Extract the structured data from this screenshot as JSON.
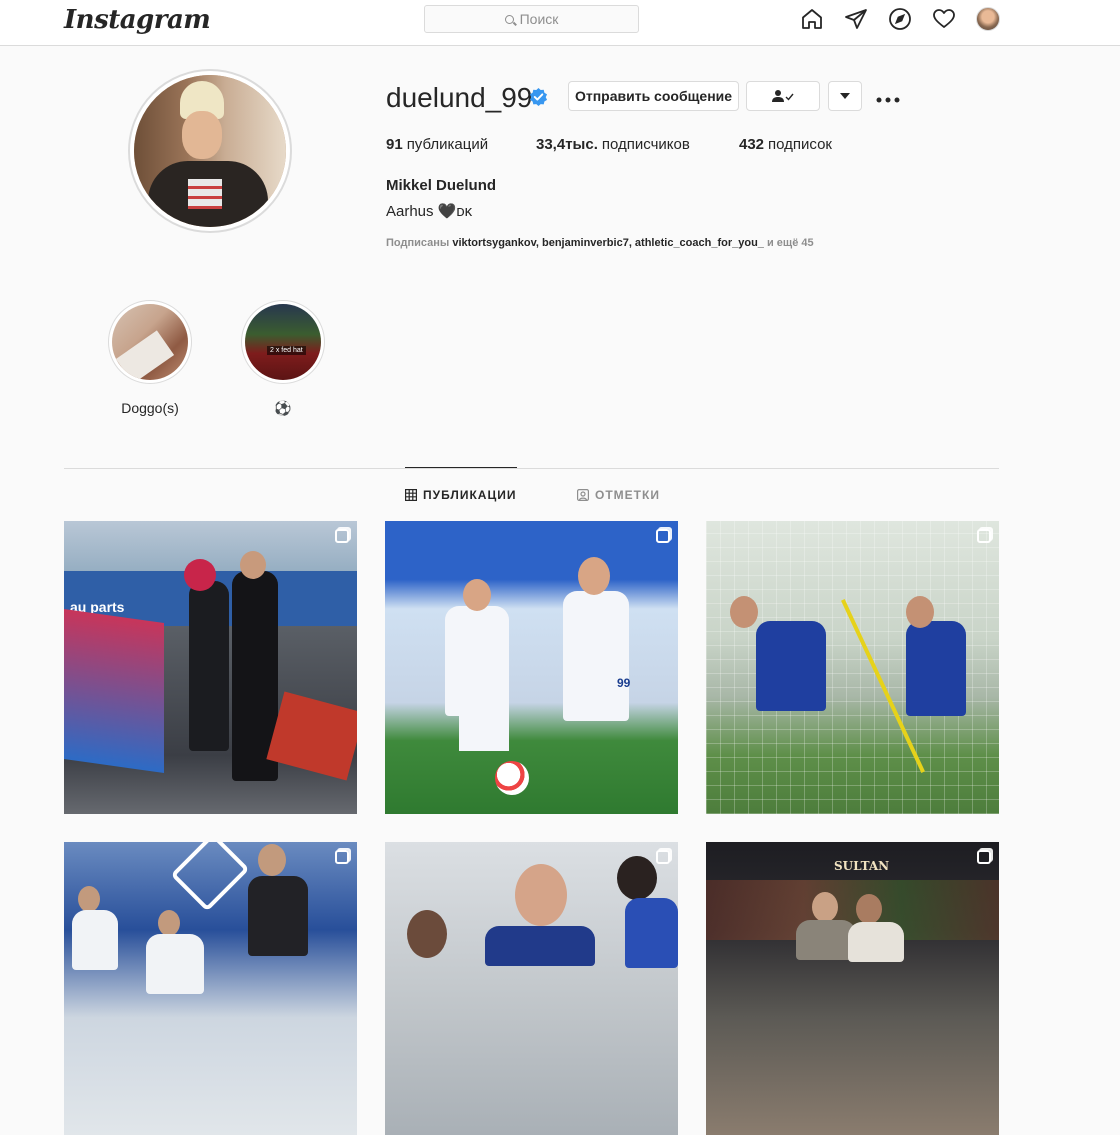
{
  "nav": {
    "logo": "Instagram",
    "search_placeholder": "Поиск",
    "icons": [
      "home-icon",
      "direct-icon",
      "explore-icon",
      "activity-heart-icon",
      "profile-avatar"
    ]
  },
  "profile": {
    "username": "duelund_99",
    "verified": true,
    "message_button": "Отправить сообщение",
    "follow_button_icon": "person-check-icon",
    "more_dropdown_icon": "chevron-down-icon",
    "options_icon": "more-dots-icon",
    "stats": {
      "posts_count": "91",
      "posts_label": "публикаций",
      "followers_count": "33,4тыс.",
      "followers_label": "подписчиков",
      "following_count": "432",
      "following_label": "подписок"
    },
    "full_name": "Mikkel Duelund",
    "bio": "Aarhus 🖤ᴅᴋ",
    "followed_by_prefix": "Подписаны",
    "followed_by_users": "viktortsygankov, benjaminverbic7, athletic_coach_for_you_",
    "followed_by_suffix": "и ещё 45"
  },
  "highlights": [
    {
      "label": "Doggo(s)"
    },
    {
      "label": "⚽",
      "image_text": "2 x fed hat"
    }
  ],
  "tabs": {
    "posts": "ПУБЛИКАЦИИ",
    "tagged": "ОТМЕТКИ",
    "active": "posts"
  },
  "colors": {
    "text": "#262626",
    "muted": "#8e8e8e",
    "border": "#dbdbdb",
    "verified_blue": "#3897f0",
    "background": "#fafafa"
  },
  "posts": [
    {
      "multi": true,
      "image_text": "au parts"
    },
    {
      "multi": true,
      "image_text": "99"
    },
    {
      "multi": true
    },
    {
      "multi": true
    },
    {
      "multi": true
    },
    {
      "multi": true,
      "image_text": "SULTAN"
    }
  ]
}
